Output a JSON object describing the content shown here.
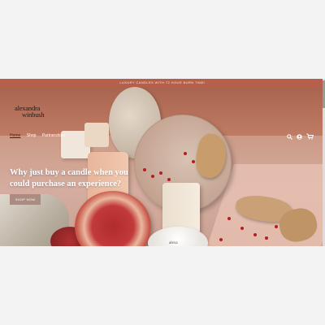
{
  "announcement": {
    "text": "LUXURY CANDLES WITH 72 HOUR BURN TIME!"
  },
  "brand": {
    "logo_line1": "alexandra",
    "logo_line2": "winbush"
  },
  "nav": {
    "items": [
      {
        "label": "Home",
        "active": true
      },
      {
        "label": "Shop",
        "active": false
      },
      {
        "label": "Partnerships",
        "active": false
      }
    ]
  },
  "header_icons": [
    "search-icon",
    "account-icon",
    "cart-icon"
  ],
  "hero": {
    "headline": "Why just buy a candle when you could purchase an experience?",
    "button_label": "SHOP NOW",
    "candle_label": "alexa"
  },
  "colors": {
    "announcement_bg": "#b65f4a",
    "button_bg": "#ad8b81",
    "nav_active": "#3b1f18"
  }
}
